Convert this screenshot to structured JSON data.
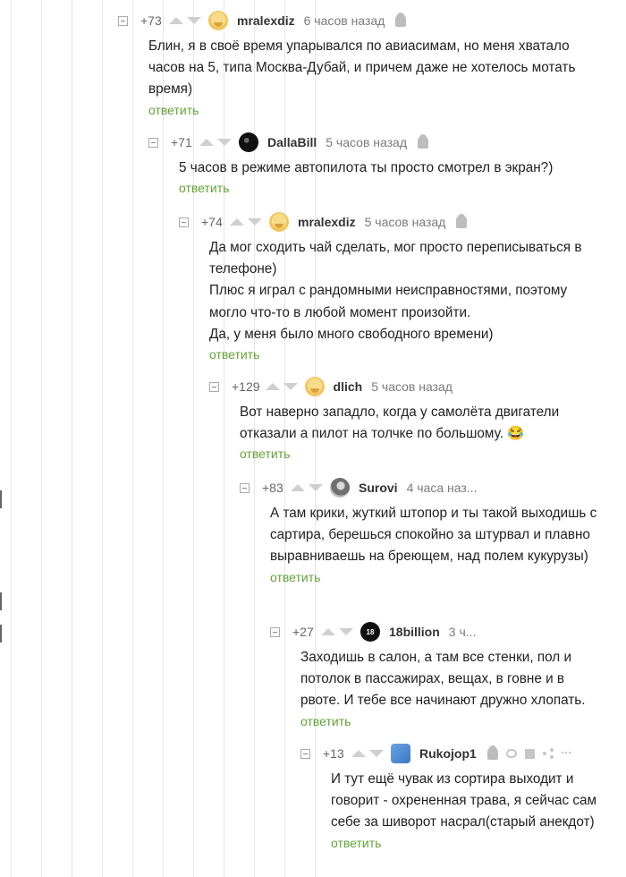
{
  "reply_label": "ответить",
  "comments": [
    {
      "rating": "+73",
      "author": "mralexdiz",
      "time": "6 часов назад",
      "text": "Блин, я в своё время упарывался по авиасимам, но меня хватало часов на 5, типа Москва-Дубай, и причем даже не хотелось мотать время)",
      "avatar": "emoji-face"
    },
    {
      "rating": "+71",
      "author": "DallaBill",
      "time": "5 часов назад",
      "text": "5 часов в режиме автопилота ты просто смотрел в экран?)",
      "avatar": "dark-round"
    },
    {
      "rating": "+74",
      "author": "mralexdiz",
      "time": "5 часов назад",
      "text": "Да мог сходить чай сделать, мог просто переписываться в телефоне)\nПлюс я играл с рандомными неисправностями, поэтому могло что-то в любой момент произойти.\nДа, у меня было много свободного времени)",
      "avatar": "emoji-face"
    },
    {
      "rating": "+129",
      "author": "dlich",
      "time": "5 часов назад",
      "text": "Вот наверно западло, когда у самолёта двигатели отказали а пилот на толчке по большому. 😂",
      "avatar": "emoji-face"
    },
    {
      "rating": "+83",
      "author": "Surovi",
      "time": "4 часа наз...",
      "text": "А там крики, жуткий штопор и ты такой выходишь с сартира, берешься спокойно за штурвал и плавно выравниваешь на бреющем, над полем кукурузы)",
      "avatar": "gray-photo"
    },
    {
      "rating": "+27",
      "author": "18billion",
      "time": "3 ч...",
      "text": "Заходишь в салон, а там все стенки, пол и потолок в пассажирах, вещах, в говне и в рвоте. И тебе все начинают дружно хлопать.",
      "avatar": "18-logo"
    },
    {
      "rating": "+13",
      "author": "Rukojop1",
      "time": "",
      "text": "И тут ещё чувак из сортира выходит и говорит - охрененная трава, я сейчас сам себе за шиворот насрал(старый анекдот)",
      "avatar": "blue-square"
    }
  ]
}
